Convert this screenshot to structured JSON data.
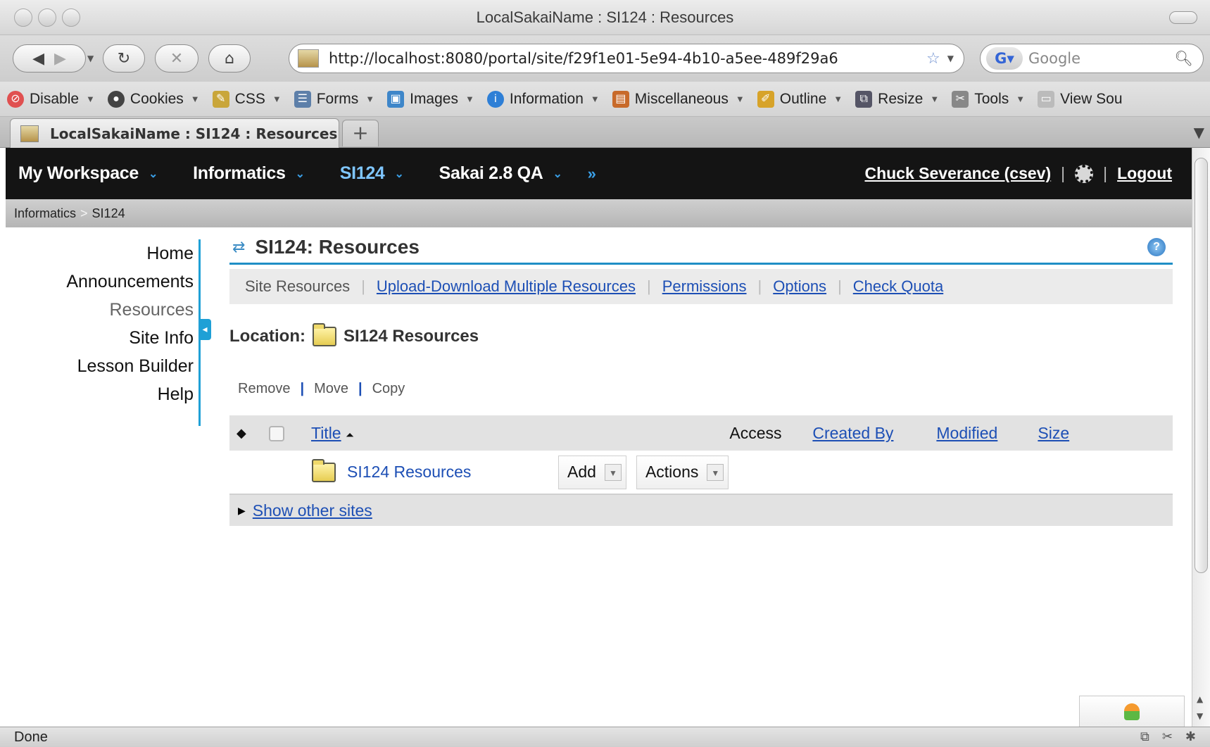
{
  "browser": {
    "window_title": "LocalSakaiName : SI124 : Resources",
    "url": "http://localhost:8080/portal/site/f29f1e01-5e94-4b10-a5ee-489f29a6",
    "search_placeholder": "Google",
    "tab_title": "LocalSakaiName : SI124 : Resources",
    "new_tab": "+",
    "status": "Done",
    "devbar": [
      "Disable",
      "Cookies",
      "CSS",
      "Forms",
      "Images",
      "Information",
      "Miscellaneous",
      "Outline",
      "Resize",
      "Tools",
      "View Sou"
    ]
  },
  "sakai": {
    "sites": [
      {
        "label": "My Workspace"
      },
      {
        "label": "Informatics"
      },
      {
        "label": "SI124"
      },
      {
        "label": "Sakai 2.8 QA"
      }
    ],
    "more_sites": "»",
    "user": "Chuck Severance (csev)",
    "logout": "Logout",
    "breadcrumb": [
      "Informatics",
      "SI124"
    ],
    "tools": [
      "Home",
      "Announcements",
      "Resources",
      "Site Info",
      "Lesson Builder",
      "Help"
    ],
    "active_tool": "Resources",
    "portlet_title": "SI124: Resources",
    "toolbar": {
      "current": "Site Resources",
      "links": [
        "Upload-Download Multiple Resources",
        "Permissions",
        "Options",
        "Check Quota"
      ]
    },
    "location_label": "Location:",
    "location_folder": "SI124 Resources",
    "actions": [
      "Remove",
      "Move",
      "Copy"
    ],
    "table": {
      "headers": {
        "title": "Title",
        "access": "Access",
        "created_by": "Created By",
        "modified": "Modified",
        "size": "Size"
      },
      "rows": [
        {
          "title": "SI124 Resources",
          "add_label": "Add",
          "actions_label": "Actions"
        }
      ]
    },
    "show_other_sites": "Show other sites"
  },
  "colors": {
    "top_nav_bg": "#141414",
    "current_site": "#7fc6ff",
    "accent_blue": "#1fa0d6",
    "link": "#1d4fb5"
  }
}
